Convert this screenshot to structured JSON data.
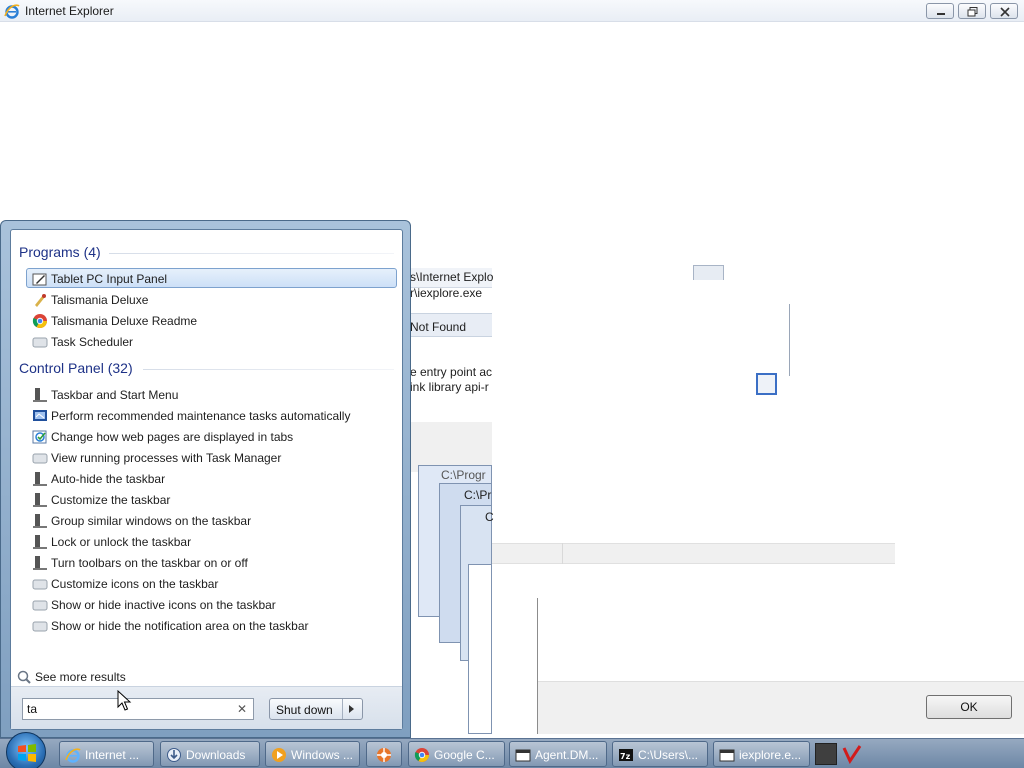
{
  "window": {
    "title": "Internet Explorer"
  },
  "background_fragments": {
    "path1": "s\\Internet Explo",
    "path2": "r\\iexplore.exe",
    "status": "Not Found",
    "msg1": "e entry point ac",
    "msg2": "ink library api-r",
    "stack1": "C:\\Progr",
    "stack2": "C:\\Pr",
    "stack3": "C",
    "ok_label": "OK"
  },
  "start_menu": {
    "programs_heading": "Programs (4)",
    "programs": [
      {
        "label": "Tablet PC Input Panel",
        "icon": "pen-icon"
      },
      {
        "label": "Talismania Deluxe",
        "icon": "game-icon"
      },
      {
        "label": "Talismania Deluxe Readme",
        "icon": "chrome-icon"
      },
      {
        "label": "Task Scheduler",
        "icon": "scheduler-icon"
      }
    ],
    "control_panel_heading": "Control Panel (32)",
    "control_panel": [
      {
        "label": "Taskbar and Start Menu"
      },
      {
        "label": "Perform recommended maintenance tasks automatically"
      },
      {
        "label": "Change how web pages are displayed in tabs"
      },
      {
        "label": "View running processes with Task Manager"
      },
      {
        "label": "Auto-hide the taskbar"
      },
      {
        "label": "Customize the taskbar"
      },
      {
        "label": "Group similar windows on the taskbar"
      },
      {
        "label": "Lock or unlock the taskbar"
      },
      {
        "label": "Turn toolbars on the taskbar on or off"
      },
      {
        "label": "Customize icons on the taskbar"
      },
      {
        "label": "Show or hide inactive icons on the taskbar"
      },
      {
        "label": "Show or hide the notification area on the taskbar"
      }
    ],
    "see_more": "See more results",
    "search_value": "ta",
    "shutdown_label": "Shut down"
  },
  "taskbar": {
    "items": [
      {
        "label": "Internet ...",
        "icon": "ie-icon"
      },
      {
        "label": "Downloads",
        "icon": "downloads-icon"
      },
      {
        "label": "Windows ...",
        "icon": "media-icon"
      },
      {
        "label": "",
        "icon": "app-icon"
      },
      {
        "label": "Google C...",
        "icon": "chrome-icon"
      },
      {
        "label": "Agent.DM...",
        "icon": "window-icon"
      },
      {
        "label": "C:\\Users\\...",
        "icon": "archive-icon"
      },
      {
        "label": "iexplore.e...",
        "icon": "window-icon"
      }
    ]
  },
  "colors": {
    "heading": "#1e3287",
    "accent": "#2a6db3",
    "selection": "#cde0f7"
  }
}
